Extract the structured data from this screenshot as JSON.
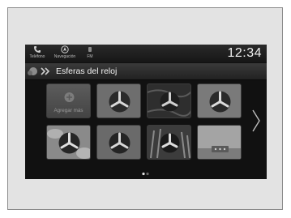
{
  "statusbar": {
    "items": [
      {
        "label": "Teléfono",
        "icon": "phone-icon"
      },
      {
        "label": "Navegación",
        "icon": "navigation-icon"
      },
      {
        "label": "FM",
        "icon": "radio-icon"
      }
    ],
    "clock": "12:34"
  },
  "header": {
    "title": "Esferas del reloj",
    "icons": [
      "home-icon",
      "forward-chevron-icon"
    ]
  },
  "grid": {
    "add_label": "Agregar más",
    "tiles": [
      {
        "name": "add-more"
      },
      {
        "name": "clock-face-1",
        "bg": "#6e6e6e"
      },
      {
        "name": "clock-face-2",
        "bg": "#3a3a3a"
      },
      {
        "name": "clock-face-3",
        "bg": "#7a7a7a"
      },
      {
        "name": "clock-face-4",
        "bg": "#8a8a8a"
      },
      {
        "name": "clock-face-5",
        "bg": "#6a6a6a"
      },
      {
        "name": "clock-face-6",
        "bg": "#4a4a4a"
      },
      {
        "name": "clock-face-7",
        "bg": "#9a9a9a"
      }
    ]
  },
  "navigation": {
    "next_icon": "chevron-right-icon"
  },
  "pager": {
    "pages": 2,
    "current": 1
  }
}
